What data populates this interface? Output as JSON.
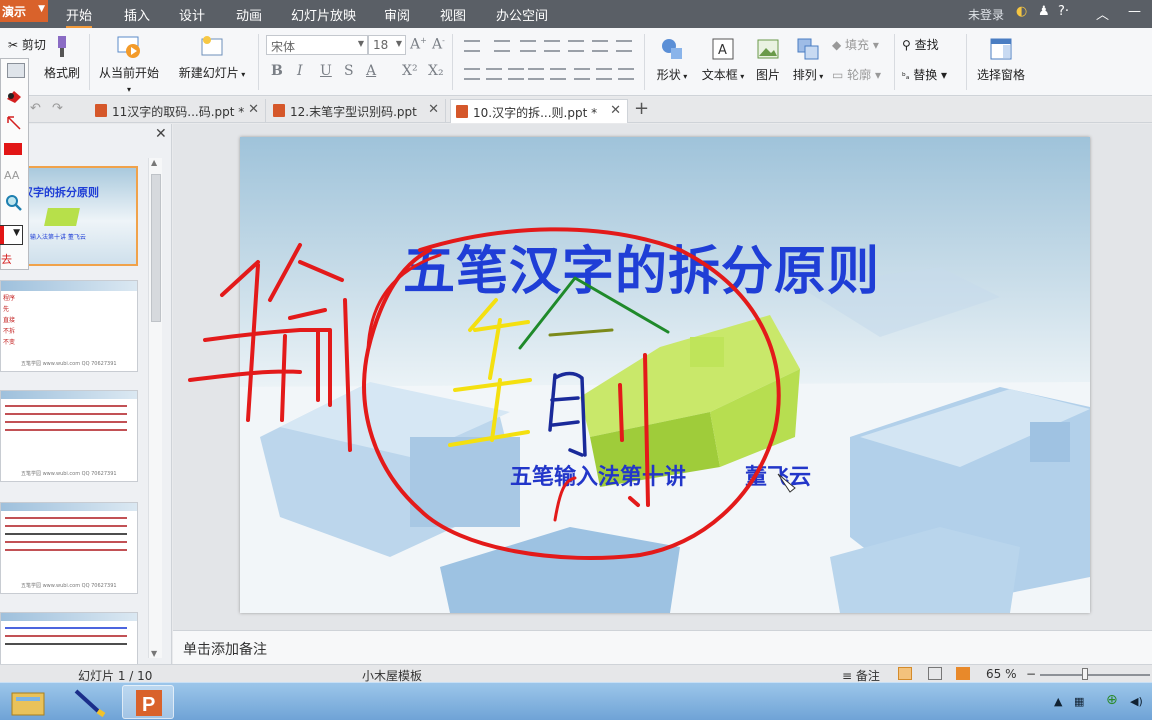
{
  "app": {
    "badge": "演示"
  },
  "menu": {
    "tabs": [
      "开始",
      "插入",
      "设计",
      "动画",
      "幻灯片放映",
      "审阅",
      "视图",
      "办公空间"
    ],
    "active": "开始",
    "login": "未登录"
  },
  "ribbon": {
    "cut": "剪切",
    "format_painter": "格式刷",
    "from_current": "从当前开始",
    "new_slide": "新建幻灯片",
    "font_name": "宋体",
    "font_size": "18",
    "shape": "形状",
    "textbox": "文本框",
    "picture": "图片",
    "arrange": "排列",
    "fill": "填充",
    "outline": "轮廓",
    "find": "查找",
    "replace": "替换",
    "select_pane": "选择窗格"
  },
  "pentools": {
    "label": "去"
  },
  "doc_tabs": [
    {
      "title": "11汉字的取码...码.ppt *",
      "active": false
    },
    {
      "title": "12.末笔字型识别码.ppt",
      "active": false
    },
    {
      "title": "10.汉字的拆...则.ppt *",
      "active": true
    }
  ],
  "thumbnails": {
    "slide1_title": "汉字的拆分原则",
    "slide1_sub": "输入法第十讲 董飞云",
    "slide2_lines": [
      "程序",
      "先",
      "直接",
      "不拆",
      "不变"
    ],
    "footer": "五笔学园 www.wubi.com   QQ 70627391"
  },
  "slide": {
    "title": "五笔汉字的拆分原则",
    "subtitle": "五笔输入法第十讲",
    "author": "董飞云",
    "accent_color": "#1f3ed6"
  },
  "notes": {
    "placeholder": "单击添加备注"
  },
  "status": {
    "slide_counter": "幻灯片 1 / 10",
    "template": "小木屋模板",
    "notes_button": "备注",
    "zoom": "65 %"
  },
  "taskbar": {
    "tasks": [
      "file-manager",
      "pen-tool",
      "presentation"
    ]
  }
}
